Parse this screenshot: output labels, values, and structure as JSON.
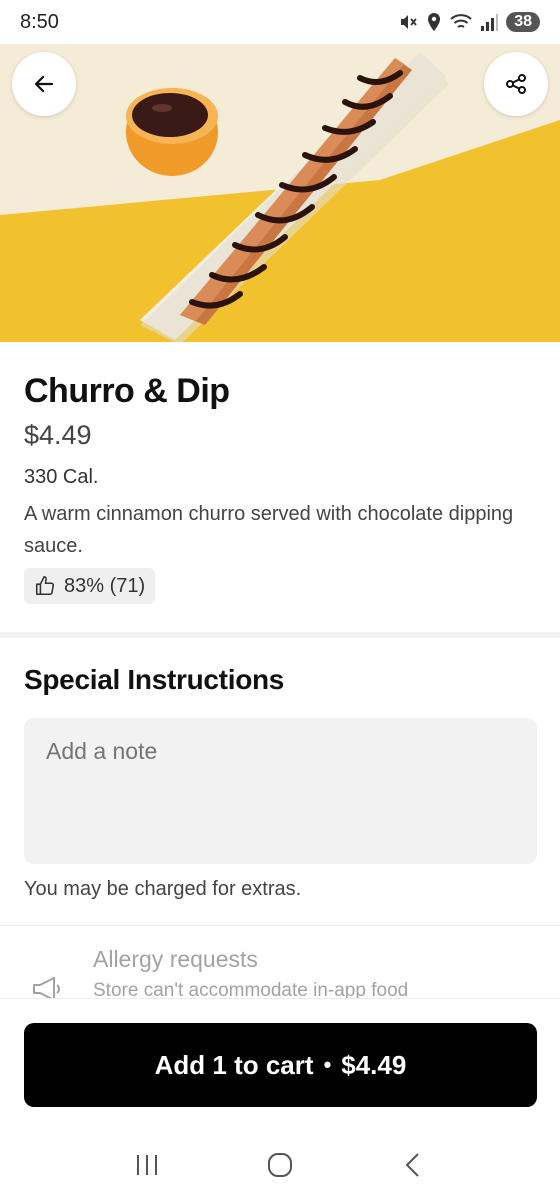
{
  "status_bar": {
    "time": "8:50",
    "battery": "38",
    "icons": [
      "mute-icon",
      "location-icon",
      "wifi-icon",
      "signal-icon",
      "battery-icon"
    ]
  },
  "header": {
    "back_icon": "arrow-left-icon",
    "share_icon": "share-icon"
  },
  "item": {
    "title": "Churro & Dip",
    "price": "$4.49",
    "calories": "330 Cal.",
    "description": "A warm cinnamon churro served with chocolate dipping sauce.",
    "rating": "83% (71)",
    "rating_icon": "thumbs-up-icon"
  },
  "special_instructions": {
    "title": "Special Instructions",
    "placeholder": "Add a note",
    "extras_note": "You may be charged for extras."
  },
  "allergy": {
    "title": "Allergy requests",
    "subtitle": "Store can't accommodate in-app food",
    "icon": "megaphone-icon"
  },
  "cart": {
    "label": "Add 1 to cart",
    "separator": "•",
    "price": "$4.49"
  },
  "nav": {
    "icons": [
      "recent-apps-icon",
      "home-icon",
      "back-icon"
    ]
  },
  "colors": {
    "background_yellow": "#f2c12e",
    "background_cream": "#f6efd9",
    "button_black": "#000000"
  }
}
